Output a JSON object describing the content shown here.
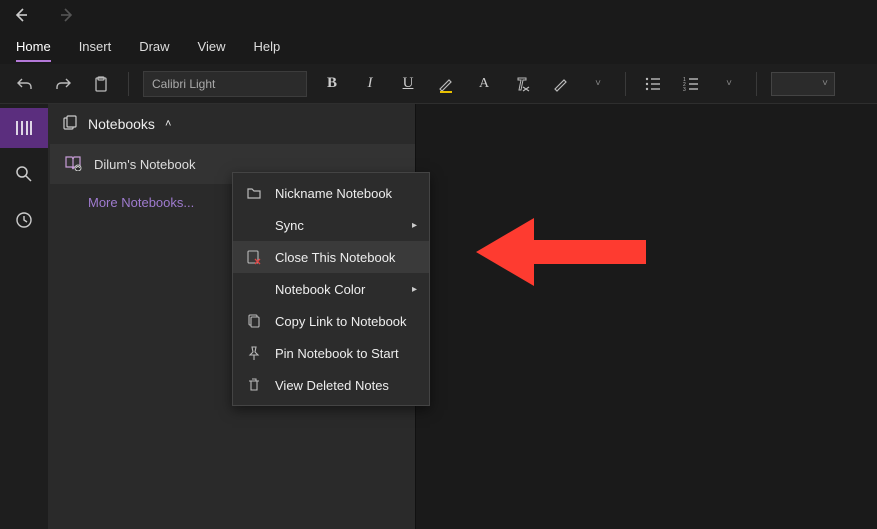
{
  "tabs": {
    "home": "Home",
    "insert": "Insert",
    "draw": "Draw",
    "view": "View",
    "help": "Help"
  },
  "ribbon": {
    "font": "Calibri Light"
  },
  "sidebar": {
    "header": "Notebooks",
    "notebook": "Dilum's Notebook",
    "more": "More Notebooks..."
  },
  "ctx": {
    "nickname": "Nickname Notebook",
    "sync": "Sync",
    "close": "Close This Notebook",
    "color": "Notebook Color",
    "copylink": "Copy Link to Notebook",
    "pin": "Pin Notebook to Start",
    "deleted": "View Deleted Notes"
  }
}
